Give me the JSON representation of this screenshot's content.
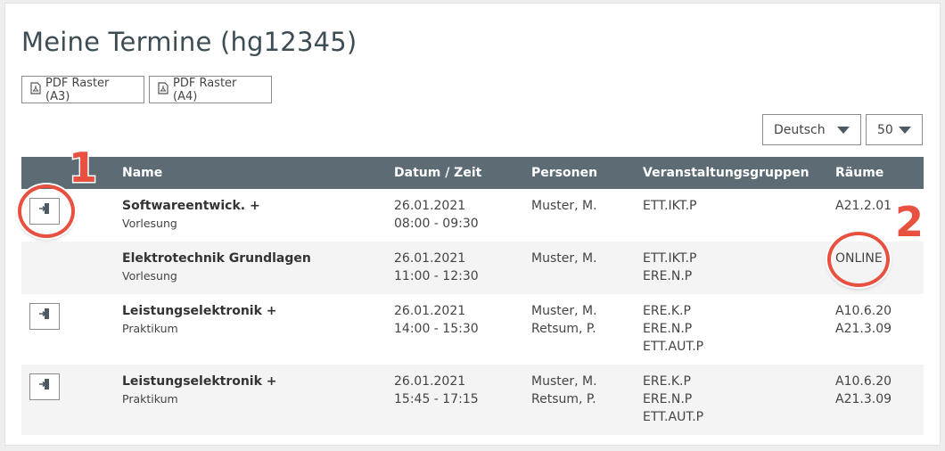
{
  "page": {
    "title": "Meine Termine (hg12345)"
  },
  "toolbar": {
    "pdf_a3": "PDF Raster (A3)",
    "pdf_a4": "PDF Raster (A4)",
    "language": "Deutsch",
    "page_size": "50"
  },
  "table": {
    "columns": {
      "name": "Name",
      "datetime": "Datum / Zeit",
      "persons": "Personen",
      "groups": "Veranstaltungsgruppen",
      "rooms": "Räume"
    },
    "rows": [
      {
        "name": "Softwareentwick. +",
        "type": "Vorlesung",
        "date": "26.01.2021",
        "time": "08:00 - 09:30",
        "persons": [
          "Muster, M."
        ],
        "groups": [
          "ETT.IKT.P"
        ],
        "rooms": [
          "A21.2.01"
        ],
        "has_join": true
      },
      {
        "name": "Elektrotechnik Grundlagen",
        "type": "Vorlesung",
        "date": "26.01.2021",
        "time": "11:00 - 12:30",
        "persons": [
          "Muster, M."
        ],
        "groups": [
          "ETT.IKT.P",
          "ERE.N.P"
        ],
        "rooms": [
          "ONLINE"
        ],
        "has_join": false
      },
      {
        "name": "Leistungselektronik +",
        "type": "Praktikum",
        "date": "26.01.2021",
        "time": "14:00 - 15:30",
        "persons": [
          "Muster, M.",
          "Retsum, P."
        ],
        "groups": [
          "ERE.K.P",
          "ERE.N.P",
          "ETT.AUT.P"
        ],
        "rooms": [
          "A10.6.20",
          "A21.3.09"
        ],
        "has_join": true
      },
      {
        "name": "Leistungselektronik +",
        "type": "Praktikum",
        "date": "26.01.2021",
        "time": "15:45 - 17:15",
        "persons": [
          "Muster, M.",
          "Retsum, P."
        ],
        "groups": [
          "ERE.K.P",
          "ERE.N.P",
          "ETT.AUT.P"
        ],
        "rooms": [
          "A10.6.20",
          "A21.3.09"
        ],
        "has_join": true
      }
    ]
  },
  "annotations": {
    "marker_1": "1",
    "marker_2": "2"
  },
  "colors": {
    "header_bg": "#5c6b74",
    "title": "#3d4d56",
    "annotation": "#e8503f",
    "row_alt": "#f4f4f4"
  },
  "icons": {
    "pdf": "pdf-file-icon",
    "join": "enter-door-icon",
    "dropdown": "caret-down-icon"
  }
}
